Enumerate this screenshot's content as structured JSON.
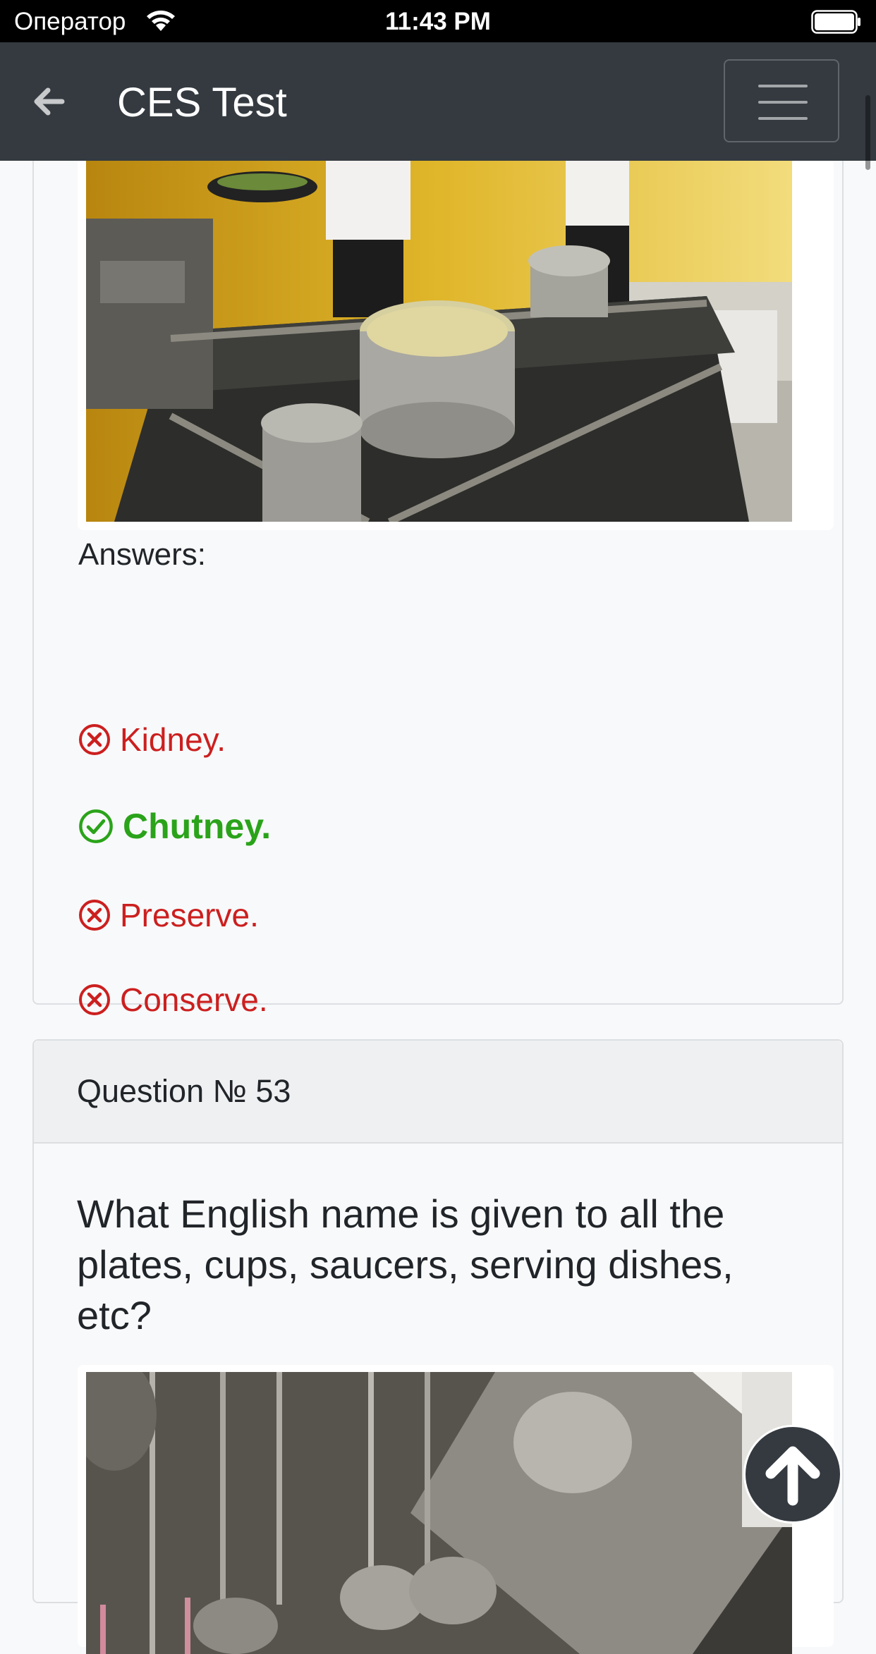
{
  "status_bar": {
    "carrier": "Оператор",
    "time": "11:43 PM"
  },
  "navbar": {
    "title": "CES Test"
  },
  "previous_question": {
    "answers_label": "Answers:",
    "answers": [
      {
        "text": "Kidney.",
        "correct": false
      },
      {
        "text": "Chutney.",
        "correct": true
      },
      {
        "text": "Preserve.",
        "correct": false
      },
      {
        "text": "Conserve.",
        "correct": false
      }
    ]
  },
  "current_question": {
    "header": "Question № 53",
    "text": "What English name is given to all the plates, cups, saucers, serving dishes, etc?"
  },
  "colors": {
    "correct": "#2aa31a",
    "wrong": "#cc1f1f",
    "navbar": "#343a40"
  },
  "icons": {
    "correct": "check-circle-icon",
    "wrong": "x-circle-icon",
    "back": "arrow-left-icon",
    "menu": "hamburger-icon",
    "scroll_top": "arrow-up-icon"
  }
}
